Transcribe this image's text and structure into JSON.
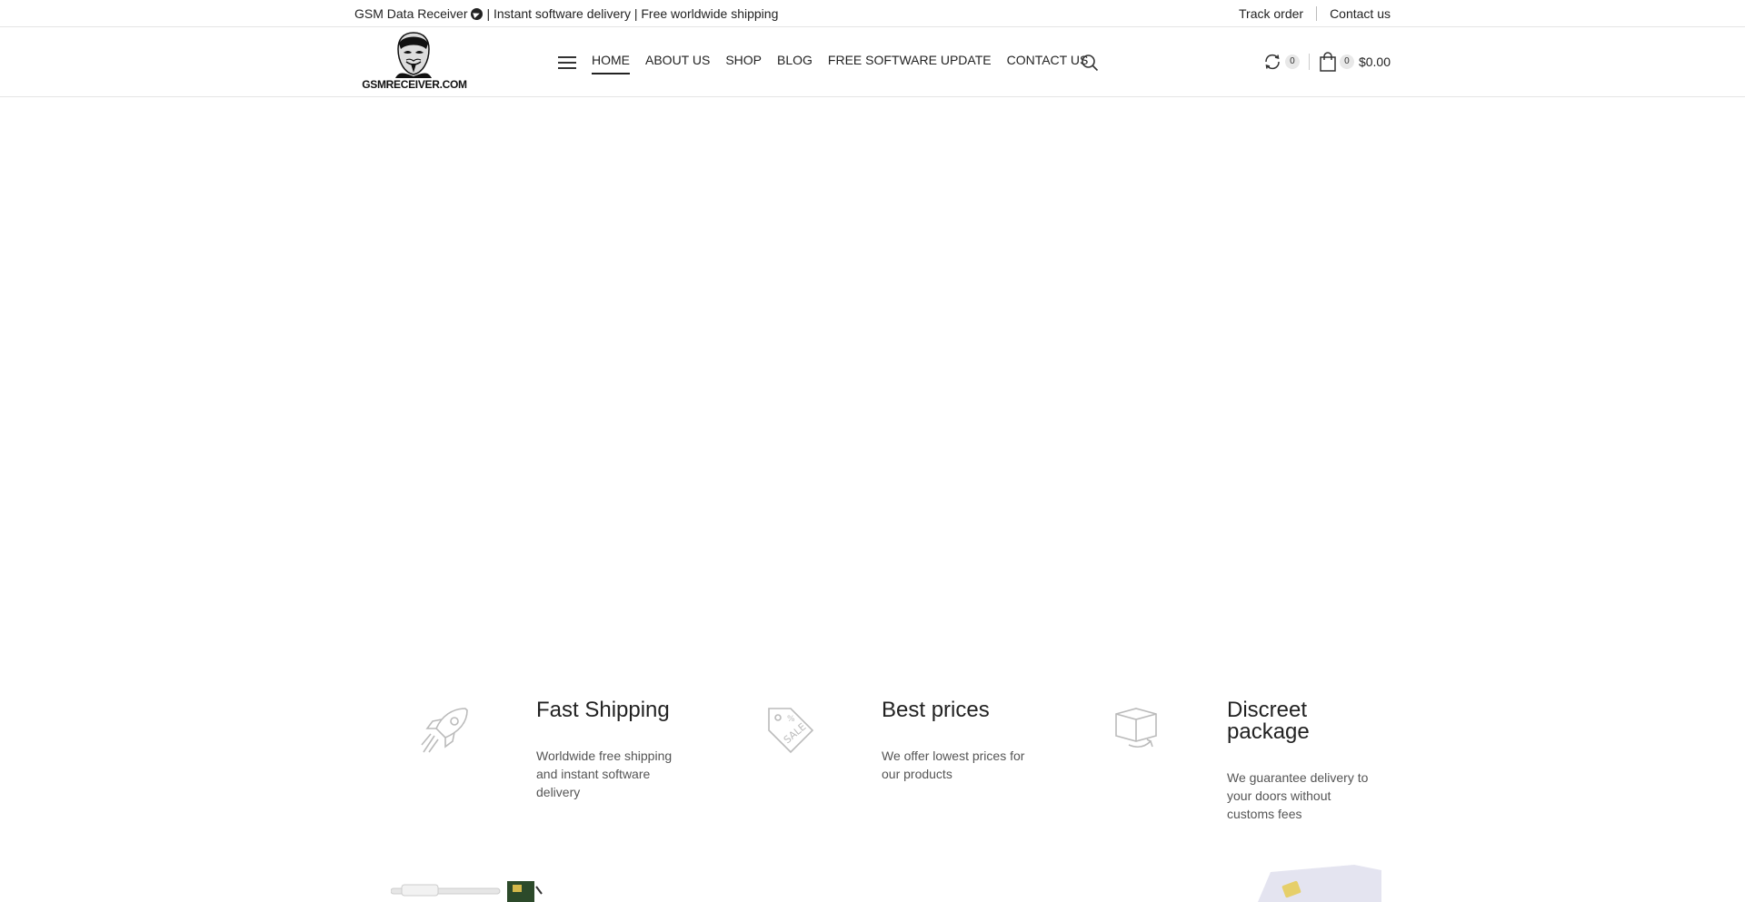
{
  "topbar": {
    "tagline_start": "GSM Data Receiver",
    "tagline_end": "| Instant software delivery | Free worldwide shipping",
    "track_order": "Track order",
    "contact_us": "Contact us"
  },
  "header": {
    "logo_text": "GSMRECEIVER.COM",
    "nav": [
      "HOME",
      "ABOUT US",
      "SHOP",
      "BLOG",
      "FREE SOFTWARE UPDATE",
      "CONTACT US"
    ],
    "active_nav": "HOME",
    "compare_count": "0",
    "cart_count": "0",
    "cart_total": "$0.00"
  },
  "features": [
    {
      "icon": "rocket-icon",
      "title": "Fast Shipping",
      "desc": "Worldwide free shipping and instant software delivery"
    },
    {
      "icon": "sale-tag-icon",
      "title": "Best prices",
      "desc": "We offer lowest prices for our products"
    },
    {
      "icon": "package-icon",
      "title": "Discreet package",
      "desc": "We guarantee delivery to your doors without customs fees"
    }
  ],
  "colors": {
    "text": "#222222",
    "muted": "#555555",
    "border": "#e5e5e5",
    "icon": "#bbbbbb"
  }
}
